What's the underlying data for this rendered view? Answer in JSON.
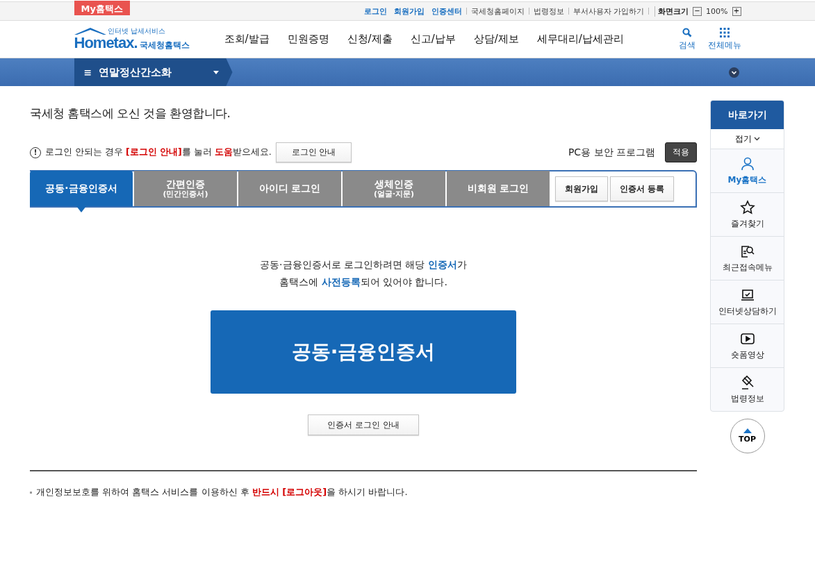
{
  "top_bar": {
    "my_tab": "My홈택스",
    "links": [
      {
        "label": "로그인",
        "kind": "strong"
      },
      {
        "label": "회원가입",
        "kind": "strong"
      },
      {
        "label": "인증센터",
        "kind": "strong"
      },
      {
        "label": "국세청홈페이지",
        "kind": "plain"
      },
      {
        "label": "법령정보",
        "kind": "plain"
      },
      {
        "label": "부서사용자 가입하기",
        "kind": "plain"
      }
    ],
    "zoom_label": "화면크기",
    "zoom_minus": "−",
    "zoom_value": "100%",
    "zoom_plus": "+"
  },
  "header": {
    "logo_small": "인터넷 납세서비스",
    "logo_main": "Hometax.",
    "logo_sub": "국세청홈택스",
    "menu": [
      "조회/발급",
      "민원증명",
      "신청/제출",
      "신고/납부",
      "상담/제보",
      "세무대리/납세관리"
    ],
    "search": "검색",
    "all_menu": "전체메뉴"
  },
  "breadcrumb": {
    "menu_icon": "≡",
    "title": "연말정산간소화"
  },
  "welcome": "국세청 홈택스에 오신 것을 환영합니다.",
  "help": {
    "icon": "!",
    "segments": [
      {
        "text": "로그인 안되는 경우 ",
        "kind": "plain"
      },
      {
        "text": "[로그인 안내]",
        "kind": "red"
      },
      {
        "text": "를 눌러 ",
        "kind": "plain"
      },
      {
        "text": "도움",
        "kind": "red"
      },
      {
        "text": "받으세요.",
        "kind": "plain"
      }
    ],
    "button": "로그인 안내"
  },
  "security": {
    "label": "PC용 보안 프로그램",
    "button": "적용"
  },
  "tabs": [
    {
      "label": "공동·금융인증서",
      "selected": true
    },
    {
      "label": "간편인증",
      "sub": "(민간인증서)",
      "selected": false
    },
    {
      "label": "아이디 로그인",
      "selected": false
    },
    {
      "label": "생체인증",
      "sub": "(얼굴·지문)",
      "selected": false
    },
    {
      "label": "비회원 로그인",
      "selected": false
    }
  ],
  "side_buttons": [
    "회원가입",
    "인증서 등록"
  ],
  "notice_lines": [
    [
      {
        "text": "공동·금융인증서로 로그인하려면 해당 ",
        "kind": "plain"
      },
      {
        "text": "인증서",
        "kind": "blue"
      },
      {
        "text": "가",
        "kind": "plain"
      }
    ],
    [
      {
        "text": "홈택스에 ",
        "kind": "plain"
      },
      {
        "text": "사전등록",
        "kind": "blue"
      },
      {
        "text": "되어 있어야 합니다.",
        "kind": "plain"
      }
    ]
  ],
  "main_button": "공동·금융인증서",
  "guide_button": "인증서 로그인 안내",
  "footer_note": [
    {
      "text": "개인정보보호를 위하여 홈택스 서비스를 이용하신 후 ",
      "kind": "plain"
    },
    {
      "text": "반드시 [로그아웃]",
      "kind": "red"
    },
    {
      "text": "을 하시기 바랍니다.",
      "kind": "plain"
    }
  ],
  "quick": {
    "title": "바로가기",
    "collapse": "접기",
    "items": [
      {
        "label": "My홈택스",
        "kind": "person",
        "active": true
      },
      {
        "label": "즐겨찾기",
        "kind": "star",
        "active": false
      },
      {
        "label": "최근접속메뉴",
        "kind": "doc-search",
        "active": false
      },
      {
        "label": "인터넷상담하기",
        "kind": "laptop",
        "active": false
      },
      {
        "label": "숏폼영상",
        "kind": "play",
        "active": false
      },
      {
        "label": "법령정보",
        "kind": "gavel",
        "active": false
      }
    ],
    "top": "TOP"
  }
}
